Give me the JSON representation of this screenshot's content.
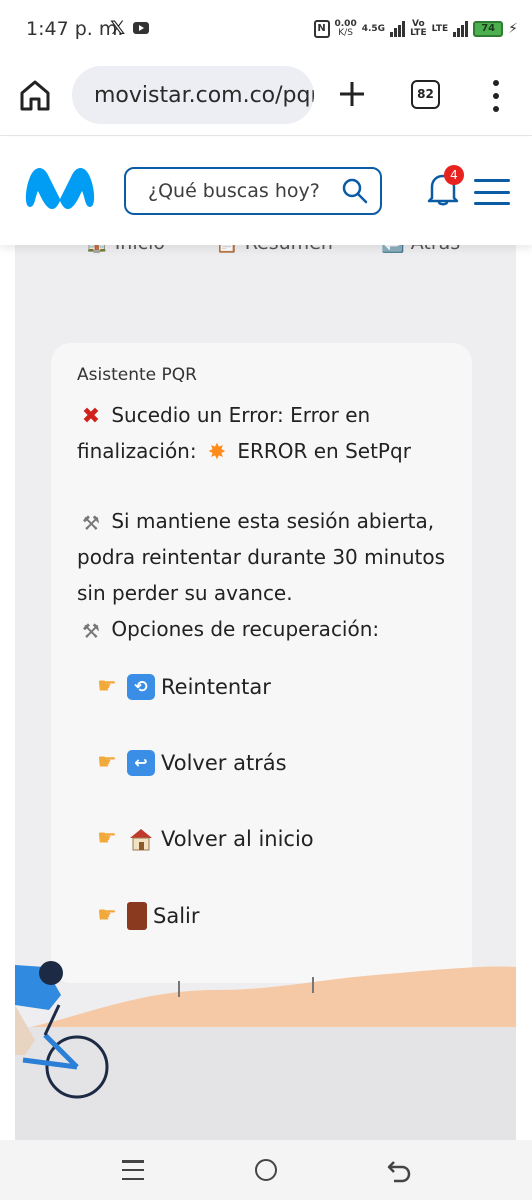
{
  "status_bar": {
    "time": "1:47 p. m.",
    "x_app": "𝕏",
    "nfc": "N",
    "net_speed": "0.00",
    "net_unit": "K/S",
    "net_type": "4.5G",
    "volte": "Vo",
    "lte_label": "LTE",
    "lte2": "LTE",
    "battery": "74"
  },
  "browser": {
    "url": "movistar.com.co/pqr",
    "tab_count": "82"
  },
  "site_header": {
    "search_placeholder": "¿Qué buscas hoy?",
    "notification_count": "4",
    "brand_color": "#019df4",
    "accent_color": "#0b5ba5"
  },
  "nav_row": {
    "items": [
      "Inicio",
      "Resumen",
      "Atrás"
    ]
  },
  "assistant": {
    "title": "Asistente PQR",
    "error_line1": "Sucedio un Error: Error en",
    "error_line2_a": "finalización:",
    "error_line2_b": "ERROR en SetPqr",
    "session_line1": "Si mantiene esta sesión abierta,",
    "session_line2": "podra reintentar durante 30 minutos",
    "session_line3": "sin perder su avance.",
    "options_heading": "Opciones de recuperación:",
    "options": [
      {
        "icon": "refresh-icon",
        "label": "Reintentar"
      },
      {
        "icon": "back-arrow-icon",
        "label": "Volver atrás"
      },
      {
        "icon": "house-icon",
        "label": "Volver al inicio"
      },
      {
        "icon": "door-icon",
        "label": "Salir"
      }
    ]
  }
}
